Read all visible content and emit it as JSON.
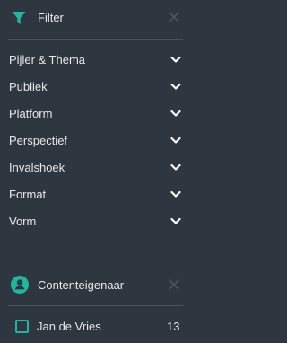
{
  "filter": {
    "title": "Filter",
    "icon": "funnel-icon",
    "close_icon": "close-icon",
    "accent": "#1fb7a0",
    "items": [
      {
        "label": "Pijler & Thema"
      },
      {
        "label": "Publiek"
      },
      {
        "label": "Platform"
      },
      {
        "label": "Perspectief"
      },
      {
        "label": "Invalshoek"
      },
      {
        "label": "Format"
      },
      {
        "label": "Vorm"
      }
    ]
  },
  "owner": {
    "title": "Contenteigenaar",
    "icon": "user-circle-icon",
    "close_icon": "close-icon",
    "options": [
      {
        "label": "Jan de Vries",
        "count": "13",
        "checked": false
      }
    ]
  }
}
